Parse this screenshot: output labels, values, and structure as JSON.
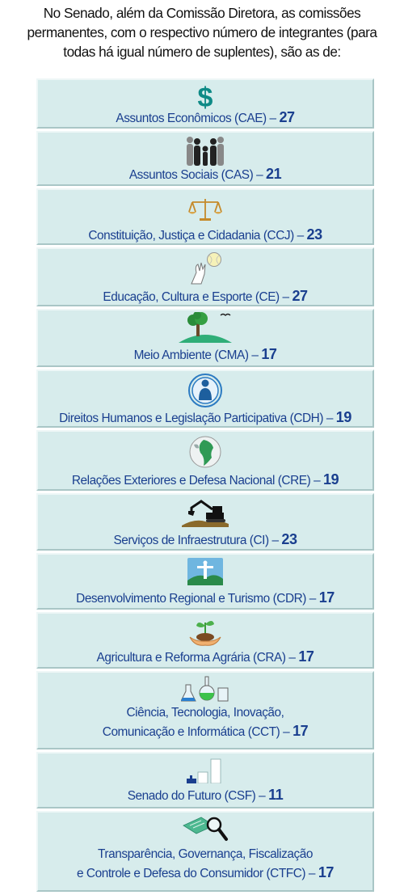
{
  "intro": {
    "line1": "No Senado, além da Comissão Diretora, as comissões",
    "line2": "permanentes, com o respectivo número de integrantes (para",
    "line3": "todas há igual número de suplentes), são as de:"
  },
  "committees": [
    {
      "name": "Assuntos Econômicos (CAE) –",
      "count": "27",
      "icon": "dollar-icon"
    },
    {
      "name": "Assuntos Sociais (CAS) –",
      "count": "21",
      "icon": "family-icon"
    },
    {
      "name": "Constituição, Justiça e Cidadania (CCJ) –",
      "count": "23",
      "icon": "scales-icon"
    },
    {
      "name": "Educação, Cultura e Esporte (CE) –",
      "count": "27",
      "icon": "hand-ball-icon"
    },
    {
      "name": "Meio Ambiente (CMA) –",
      "count": "17",
      "icon": "tree-icon"
    },
    {
      "name": "Direitos Humanos e Legislação Participativa (CDH) –",
      "count": "19",
      "icon": "person-circle-icon"
    },
    {
      "name": "Relações Exteriores e Defesa Nacional (CRE) –",
      "count": "19",
      "icon": "globe-icon"
    },
    {
      "name": "Serviços de Infraestrutura (CI) –",
      "count": "23",
      "icon": "excavator-icon"
    },
    {
      "name": "Desenvolvimento Regional e Turismo (CDR) –",
      "count": "17",
      "icon": "christ-redeemer-icon"
    },
    {
      "name": "Agricultura e Reforma Agrária (CRA) –",
      "count": "17",
      "icon": "seedling-hands-icon"
    },
    {
      "name_line1": "Ciência, Tecnologia, Inovação,",
      "name": "Comunicação e Informática (CCT) –",
      "count": "17",
      "icon": "lab-flasks-icon"
    },
    {
      "name": "Senado do Futuro (CSF) –",
      "count": "11",
      "icon": "growth-bars-icon"
    },
    {
      "name_line1": "Transparência, Governança, Fiscalização",
      "name": "e Controle e Defesa do Consumidor (CTFC) –",
      "count": "17",
      "icon": "magnifier-document-icon"
    }
  ],
  "colors": {
    "card_bg": "#d7ecec",
    "label": "#1a3f8f",
    "icon_teal": "#0e8a86"
  }
}
